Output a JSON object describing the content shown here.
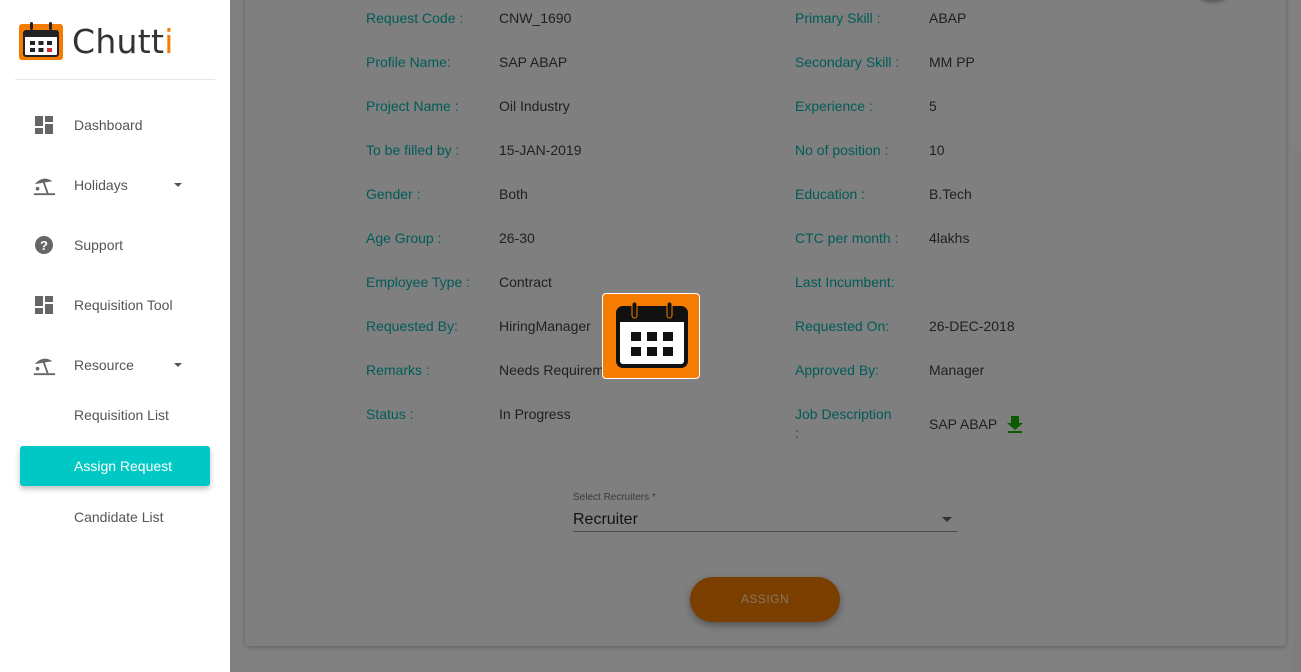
{
  "brand": {
    "name_main": "Chutt",
    "name_accent": "i"
  },
  "sidebar": {
    "items": [
      {
        "label": "Dashboard",
        "icon": "dashboard-icon"
      },
      {
        "label": "Holidays",
        "icon": "beach-icon"
      },
      {
        "label": "Support",
        "icon": "help-icon"
      },
      {
        "label": "Requisition Tool",
        "icon": "dashboard-icon"
      },
      {
        "label": "Resource",
        "icon": "beach-icon"
      },
      {
        "label": "Requisition List"
      },
      {
        "label": "Assign Request"
      },
      {
        "label": "Candidate List"
      }
    ]
  },
  "details": {
    "left": [
      {
        "label": "Request Code :",
        "value": "CNW_1690"
      },
      {
        "label": "Profile Name:",
        "value": "SAP ABAP"
      },
      {
        "label": "Project Name :",
        "value": "Oil Industry"
      },
      {
        "label": "To be filled by :",
        "value": "15-JAN-2019"
      },
      {
        "label": "Gender :",
        "value": "Both"
      },
      {
        "label": "Age Group :",
        "value": "26-30"
      },
      {
        "label": "Employee Type :",
        "value": "Contract"
      },
      {
        "label": "Requested By:",
        "value": "HiringManager"
      },
      {
        "label": "Remarks :",
        "value": "Needs Requireme"
      },
      {
        "label": "Status :",
        "value": "In Progress"
      }
    ],
    "right": [
      {
        "label": "Primary Skill :",
        "value": "ABAP"
      },
      {
        "label": "Secondary Skill :",
        "value": "MM PP"
      },
      {
        "label": "Experience :",
        "value": "5"
      },
      {
        "label": "No of position :",
        "value": "10"
      },
      {
        "label": "Education :",
        "value": "B.Tech"
      },
      {
        "label": "CTC per month :",
        "value": "4lakhs"
      },
      {
        "label": "Last Incumbent:",
        "value": ""
      },
      {
        "label": "Requested On:",
        "value": "26-DEC-2018"
      },
      {
        "label": "Approved By:",
        "value": "Manager"
      },
      {
        "label_line1": "Job Description",
        "label_line2": ":",
        "value": "SAP ABAP"
      }
    ]
  },
  "select": {
    "label": "Select Recruiters *",
    "value": "Recruiter"
  },
  "assign_button": "ASSIGN",
  "colors": {
    "accent": "#f57c00",
    "active_nav": "#00c9c5",
    "label_text": "#005c58"
  }
}
